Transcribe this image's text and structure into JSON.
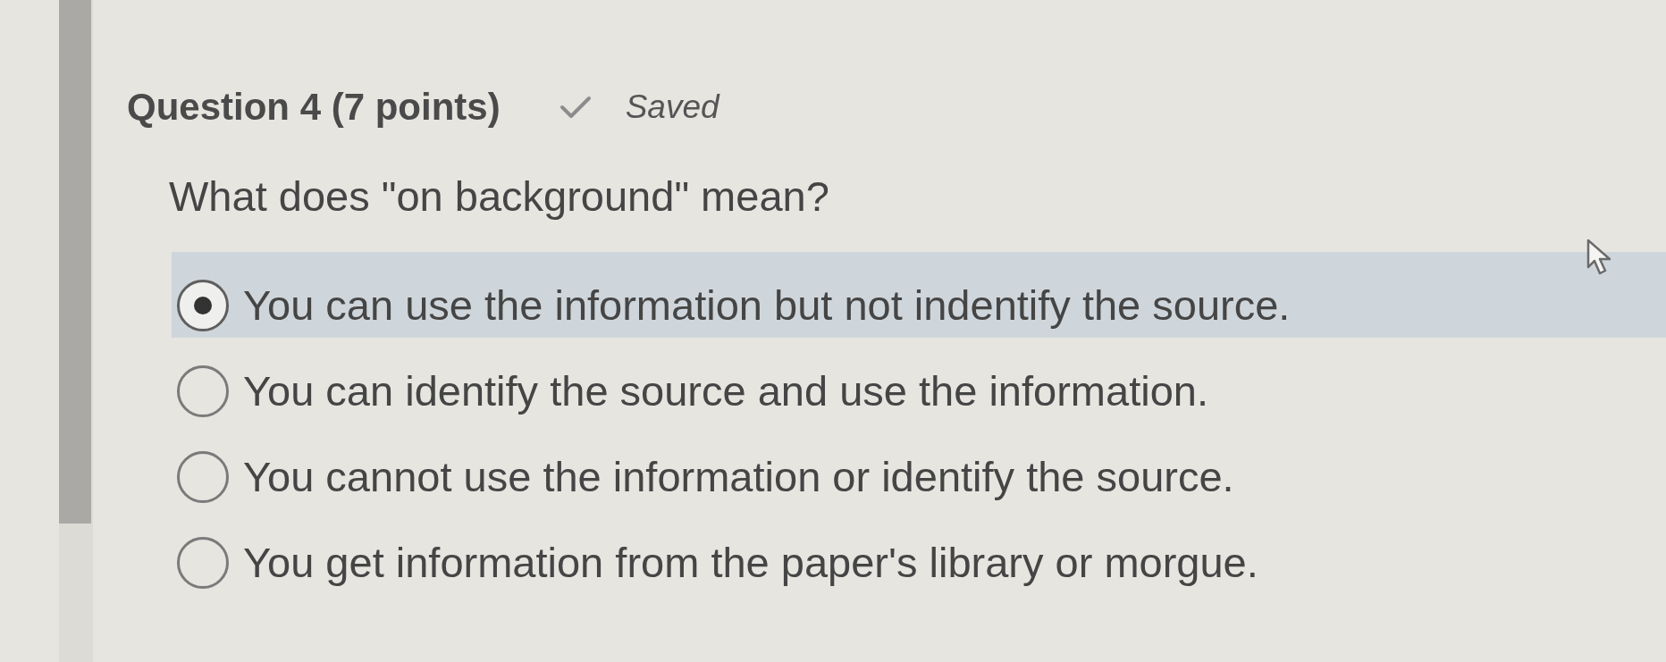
{
  "question": {
    "title": "Question 4 (7 points)",
    "save_status": "Saved",
    "prompt": "What does \"on background\" mean?",
    "options": [
      {
        "label": "You can use the information but not indentify the source.",
        "selected": true
      },
      {
        "label": "You can identify the source and use the information.",
        "selected": false
      },
      {
        "label": "You cannot use the information or identify the source.",
        "selected": false
      },
      {
        "label": "You get information from the paper's library or morgue.",
        "selected": false
      }
    ]
  }
}
